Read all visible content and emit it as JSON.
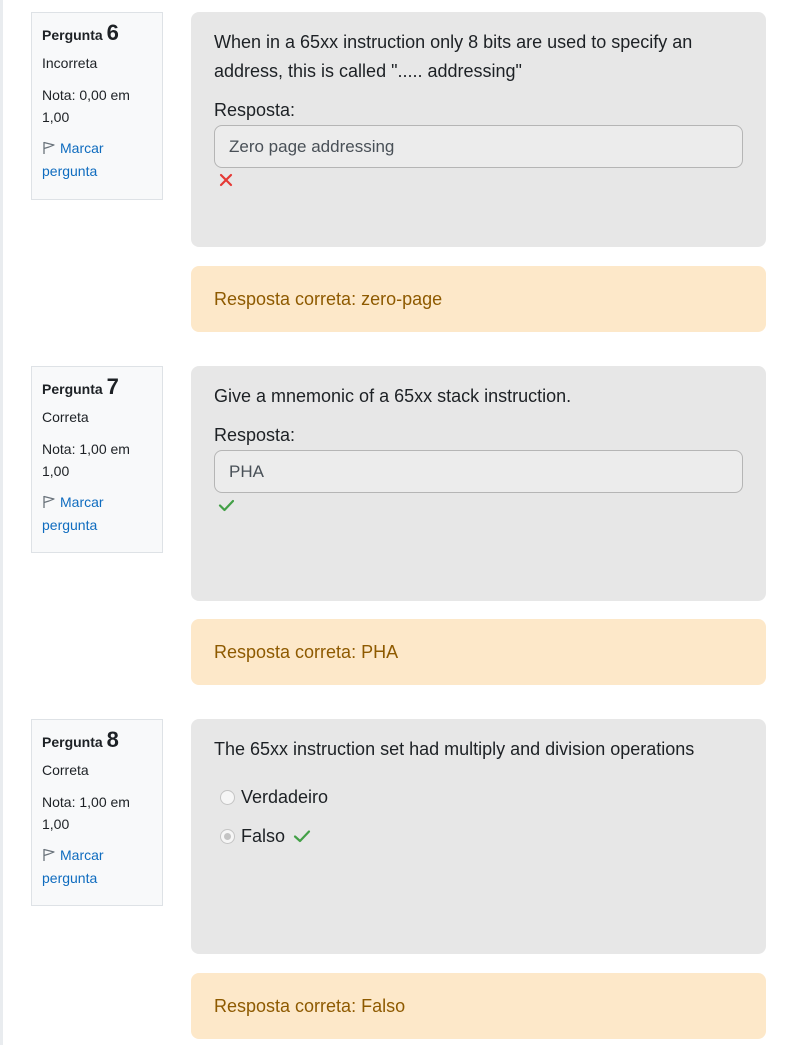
{
  "questions": [
    {
      "label": "Pergunta",
      "number": "6",
      "state": "Incorreta",
      "grade": "Nota: 0,00 em 1,00",
      "flag": "Marcar pergunta",
      "text": "When in a 65xx instruction only 8 bits are used to specify an address, this is called \"..... addressing\"",
      "answer_label": "Resposta:",
      "answer_value": "Zero page addressing",
      "result_icon": "cross-icon",
      "feedback": "Resposta correta: zero-page"
    },
    {
      "label": "Pergunta",
      "number": "7",
      "state": "Correta",
      "grade": "Nota: 1,00 em 1,00",
      "flag": "Marcar pergunta",
      "text": "Give a mnemonic of a 65xx stack instruction.",
      "answer_label": "Resposta:",
      "answer_value": "PHA",
      "result_icon": "check-icon",
      "feedback": "Resposta correta: PHA"
    },
    {
      "label": "Pergunta",
      "number": "8",
      "state": "Correta",
      "grade": "Nota: 1,00 em 1,00",
      "flag": "Marcar pergunta",
      "text": "The 65xx instruction set had multiply and division operations",
      "options": [
        {
          "label": "Verdadeiro",
          "selected": false
        },
        {
          "label": "Falso",
          "selected": true
        }
      ],
      "feedback": "Resposta correta: Falso"
    }
  ],
  "colors": {
    "link": "#0f6cbf",
    "incorrect": "#e53935",
    "correct": "#43a047",
    "feedback_bg": "#fde8c9",
    "feedback_text": "#8e5a00",
    "content_bg": "#e7e7e7"
  }
}
